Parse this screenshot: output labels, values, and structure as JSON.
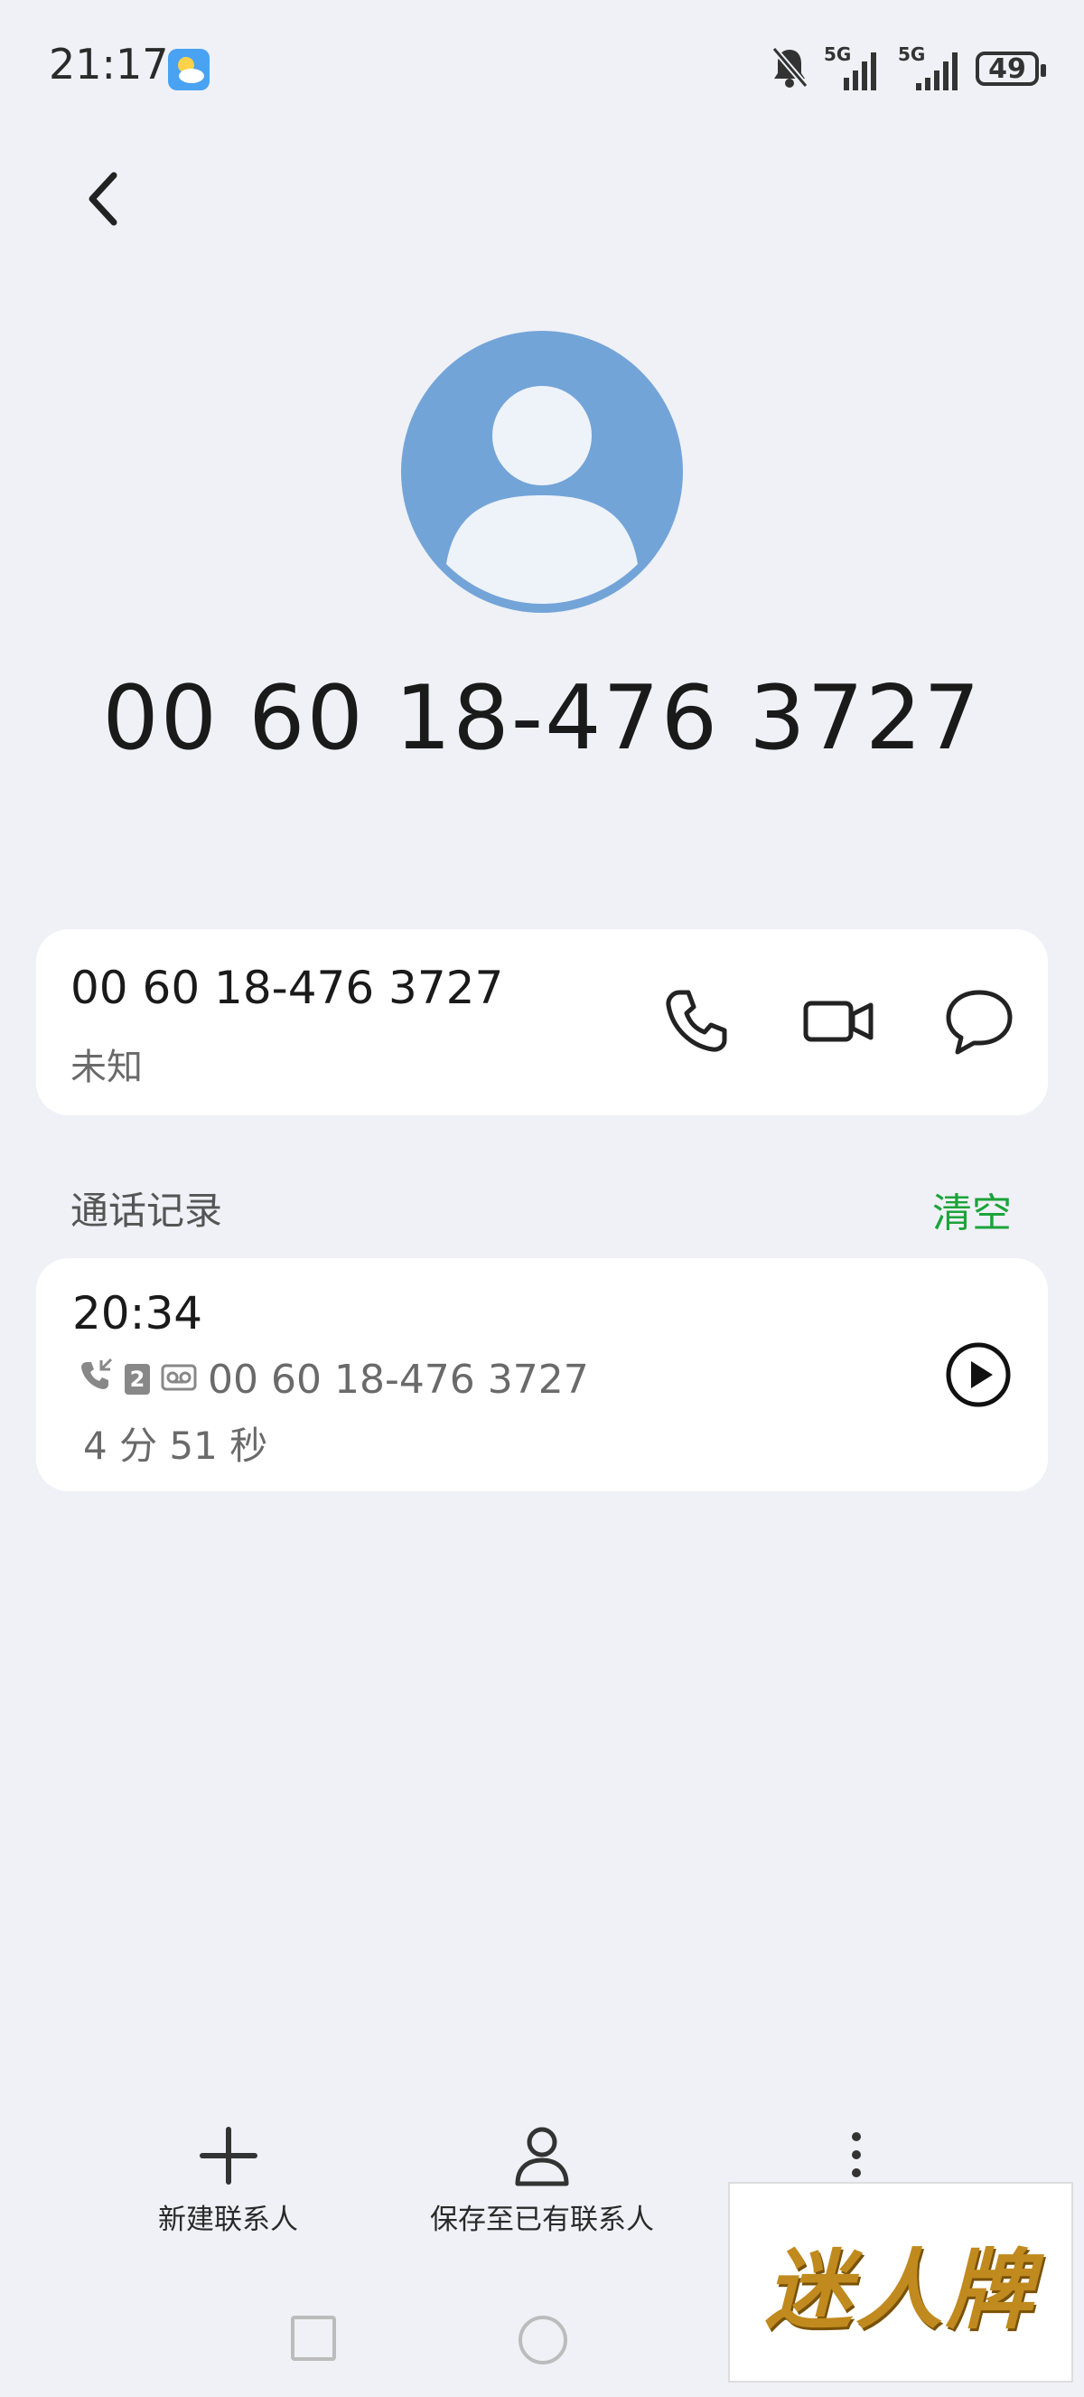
{
  "status_bar": {
    "time": "21:17",
    "battery": "49",
    "network_1": "5G",
    "network_2": "5G"
  },
  "contact": {
    "title_number": "00 60 18-476 3727"
  },
  "number_card": {
    "number": "00 60 18-476 3727",
    "location": "未知"
  },
  "call_log": {
    "section_title": "通话记录",
    "clear_label": "清空",
    "entries": [
      {
        "time": "20:34",
        "number": "00 60 18-476 3727",
        "sim": "2",
        "duration": "4 分 51 秒"
      }
    ]
  },
  "bottom_bar": {
    "new_contact": "新建联系人",
    "save_existing": "保存至已有联系人"
  },
  "watermark": {
    "text": "迷人牌"
  },
  "colors": {
    "background": "#eff1f6",
    "accent_green": "#1ca33a",
    "avatar_blue": "#73a4d8"
  }
}
